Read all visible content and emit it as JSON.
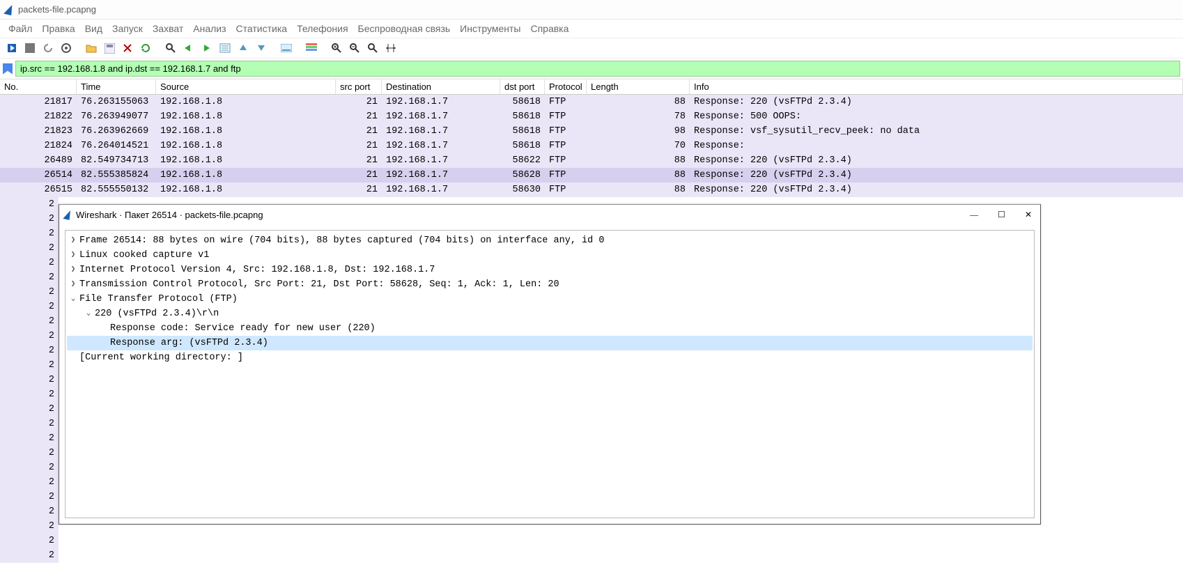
{
  "title": "packets-file.pcapng",
  "menu": [
    "Файл",
    "Правка",
    "Вид",
    "Запуск",
    "Захват",
    "Анализ",
    "Статистика",
    "Телефония",
    "Беспроводная связь",
    "Инструменты",
    "Справка"
  ],
  "filter": "ip.src == 192.168.1.8 and ip.dst == 192.168.1.7 and ftp",
  "columns": {
    "no": "No.",
    "time": "Time",
    "src": "Source",
    "srcp": "src port",
    "dst": "Destination",
    "dstp": "dst port",
    "proto": "Protocol",
    "len": "Length",
    "info": "Info"
  },
  "rows": [
    {
      "no": "21817",
      "time": "76.263155063",
      "src": "192.168.1.8",
      "srcp": "21",
      "dst": "192.168.1.7",
      "dstp": "58618",
      "proto": "FTP",
      "len": "88",
      "info": "Response: 220 (vsFTPd 2.3.4)"
    },
    {
      "no": "21822",
      "time": "76.263949077",
      "src": "192.168.1.8",
      "srcp": "21",
      "dst": "192.168.1.7",
      "dstp": "58618",
      "proto": "FTP",
      "len": "78",
      "info": "Response: 500 OOPS:"
    },
    {
      "no": "21823",
      "time": "76.263962669",
      "src": "192.168.1.8",
      "srcp": "21",
      "dst": "192.168.1.7",
      "dstp": "58618",
      "proto": "FTP",
      "len": "98",
      "info": "Response: vsf_sysutil_recv_peek: no data"
    },
    {
      "no": "21824",
      "time": "76.264014521",
      "src": "192.168.1.8",
      "srcp": "21",
      "dst": "192.168.1.7",
      "dstp": "58618",
      "proto": "FTP",
      "len": "70",
      "info": "Response:"
    },
    {
      "no": "26489",
      "time": "82.549734713",
      "src": "192.168.1.8",
      "srcp": "21",
      "dst": "192.168.1.7",
      "dstp": "58622",
      "proto": "FTP",
      "len": "88",
      "info": "Response: 220 (vsFTPd 2.3.4)"
    },
    {
      "no": "26514",
      "time": "82.555385824",
      "src": "192.168.1.8",
      "srcp": "21",
      "dst": "192.168.1.7",
      "dstp": "58628",
      "proto": "FTP",
      "len": "88",
      "info": "Response: 220 (vsFTPd 2.3.4)",
      "sel": true
    },
    {
      "no": "26515",
      "time": "82.555550132",
      "src": "192.168.1.8",
      "srcp": "21",
      "dst": "192.168.1.7",
      "dstp": "58630",
      "proto": "FTP",
      "len": "88",
      "info": "Response: 220 (vsFTPd 2.3.4)"
    }
  ],
  "partial_no": [
    "2",
    "2",
    "2",
    "2",
    "2",
    "2",
    "2",
    "2",
    "2",
    "2",
    "2",
    "2",
    "2",
    "2",
    "2",
    "2",
    "2",
    "2",
    "2",
    "2",
    "2",
    "2",
    "2",
    "2",
    "2"
  ],
  "packet_window": {
    "title": "Wireshark · Пакет 26514 · packets-file.pcapng",
    "controls": {
      "min": "—",
      "max": "☐",
      "close": "✕"
    },
    "tree": [
      {
        "arrow": ">",
        "indent": 0,
        "text": "Frame 26514: 88 bytes on wire (704 bits), 88 bytes captured (704 bits) on interface any, id 0"
      },
      {
        "arrow": ">",
        "indent": 0,
        "text": "Linux cooked capture v1"
      },
      {
        "arrow": ">",
        "indent": 0,
        "text": "Internet Protocol Version 4, Src: 192.168.1.8, Dst: 192.168.1.7"
      },
      {
        "arrow": ">",
        "indent": 0,
        "text": "Transmission Control Protocol, Src Port: 21, Dst Port: 58628, Seq: 1, Ack: 1, Len: 20"
      },
      {
        "arrow": "v",
        "indent": 0,
        "text": "File Transfer Protocol (FTP)"
      },
      {
        "arrow": "v",
        "indent": 1,
        "text": "220 (vsFTPd 2.3.4)\\r\\n"
      },
      {
        "arrow": "",
        "indent": 2,
        "text": "Response code: Service ready for new user (220)"
      },
      {
        "arrow": "",
        "indent": 2,
        "text": "Response arg: (vsFTPd 2.3.4)",
        "hl": true
      },
      {
        "arrow": "",
        "indent": 0,
        "text": "[Current working directory: ]"
      }
    ]
  }
}
